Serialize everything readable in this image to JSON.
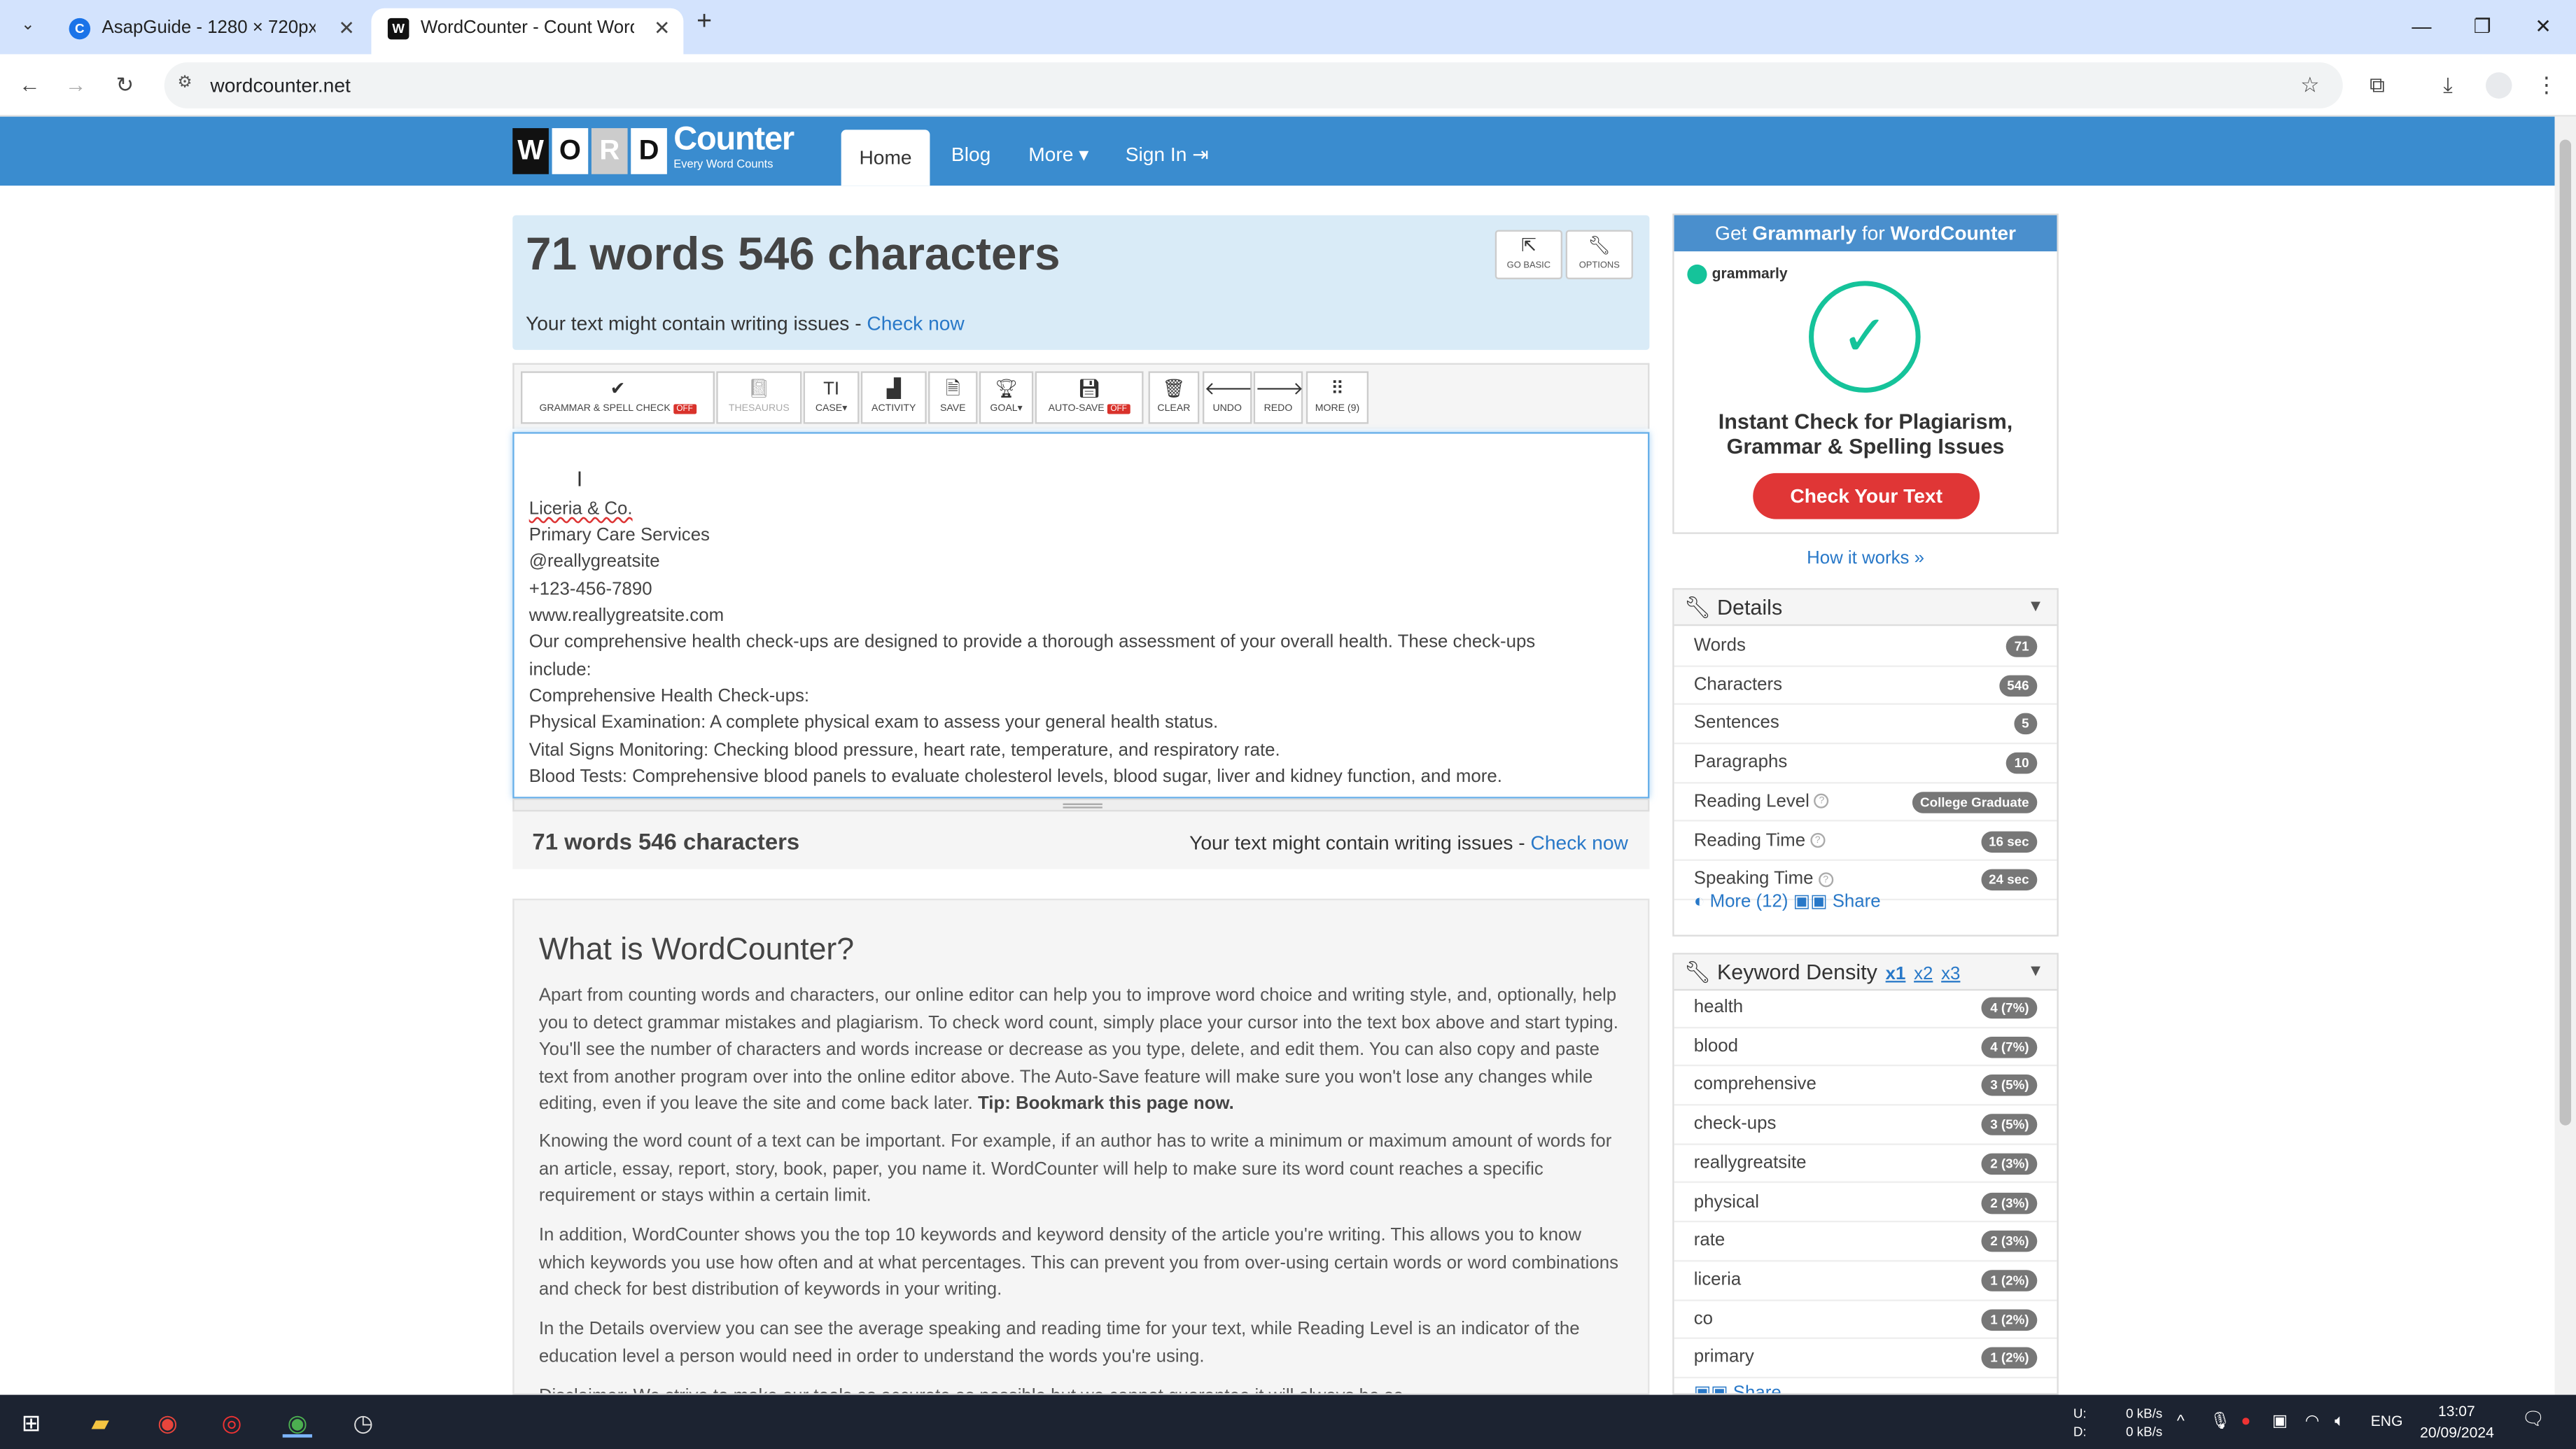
{
  "browser": {
    "tabs": [
      {
        "title": "AsapGuide - 1280 × 720px",
        "favicon": "C"
      },
      {
        "title": "WordCounter - Count Words &",
        "favicon": "W"
      }
    ],
    "url": "wordcounter.net"
  },
  "site": {
    "logo_letters": [
      "W",
      "O",
      "R",
      "D"
    ],
    "logo_word": "Counter",
    "logo_tagline": "Every Word Counts",
    "nav": {
      "home": "Home",
      "blog": "Blog",
      "more": "More ▾",
      "signin": "Sign In ⇥"
    }
  },
  "counter": {
    "headline": "71 words 546 characters",
    "issues_text": "Your text might contain writing issues - ",
    "check_now": "Check now",
    "go_basic": "GO BASIC",
    "options": "OPTIONS"
  },
  "toolbar": {
    "grammar": "GRAMMAR & SPELL CHECK",
    "off": "OFF",
    "thesaurus": "THESAURUS",
    "case": "CASE▾",
    "activity": "ACTIVITY",
    "save": "SAVE",
    "goal": "GOAL▾",
    "autosave": "AUTO-SAVE",
    "clear": "CLEAR",
    "undo": "UNDO",
    "redo": "REDO",
    "more": "MORE (9)"
  },
  "editor": {
    "lines": [
      "Liceria & Co.",
      "Primary Care Services",
      "@reallygreatsite",
      "+123-456-7890",
      "www.reallygreatsite.com",
      "Our comprehensive health check-ups are designed to provide a thorough assessment of your overall health. These check-ups",
      "include:",
      "Comprehensive Health Check-ups:",
      "Physical Examination: A complete physical exam to assess your general health status.",
      "Vital Signs Monitoring: Checking blood pressure, heart rate, temperature, and respiratory rate.",
      "Blood Tests: Comprehensive blood panels to evaluate cholesterol levels, blood sugar, liver and kidney function, and more."
    ]
  },
  "about": {
    "title": "What is WordCounter?",
    "p1": "Apart from counting words and characters, our online editor can help you to improve word choice and writing style, and, optionally, help you to detect grammar mistakes and plagiarism. To check word count, simply place your cursor into the text box above and start typing. You'll see the number of characters and words increase or decrease as you type, delete, and edit them. You can also copy and paste text from another program over into the online editor above. The Auto-Save feature will make sure you won't lose any changes while editing, even if you leave the site and come back later. ",
    "p1_tip": "Tip: Bookmark this page now.",
    "p2": "Knowing the word count of a text can be important. For example, if an author has to write a minimum or maximum amount of words for an article, essay, report, story, book, paper, you name it. WordCounter will help to make sure its word count reaches a specific requirement or stays within a certain limit.",
    "p3": "In addition, WordCounter shows you the top 10 keywords and keyword density of the article you're writing. This allows you to know which keywords you use how often and at what percentages. This can prevent you from over-using certain words or word combinations and check for best distribution of keywords in your writing.",
    "p4": "In the Details overview you can see the average speaking and reading time for your text, while Reading Level is an indicator of the education level a person would need in order to understand the words you're using.",
    "p5": "Disclaimer: We strive to make our tools as accurate as possible but we cannot guarantee it will always be so."
  },
  "ad": {
    "head_prefix": "Get ",
    "head_brand": "Grammarly",
    "head_mid": " for ",
    "head_site": "WordCounter",
    "brand": "grammarly",
    "text": "Instant Check for Plagiarism, Grammar & Spelling Issues",
    "button": "Check Your Text",
    "how": "How it works »"
  },
  "details": {
    "title": "Details",
    "rows": [
      {
        "k": "Words",
        "v": "71"
      },
      {
        "k": "Characters",
        "v": "546"
      },
      {
        "k": "Sentences",
        "v": "5"
      },
      {
        "k": "Paragraphs",
        "v": "10"
      },
      {
        "k": "Reading Level",
        "v": "College Graduate"
      },
      {
        "k": "Reading Time",
        "v": "16 sec"
      },
      {
        "k": "Speaking Time",
        "v": "24 sec"
      }
    ],
    "more": "More (12)",
    "share": "Share"
  },
  "keywords": {
    "title": "Keyword Density",
    "x1": "x1",
    "x2": "x2",
    "x3": "x3",
    "rows": [
      {
        "k": "health",
        "v": "4 (7%)"
      },
      {
        "k": "blood",
        "v": "4 (7%)"
      },
      {
        "k": "comprehensive",
        "v": "3 (5%)"
      },
      {
        "k": "check-ups",
        "v": "3 (5%)"
      },
      {
        "k": "reallygreatsite",
        "v": "2 (3%)"
      },
      {
        "k": "physical",
        "v": "2 (3%)"
      },
      {
        "k": "rate",
        "v": "2 (3%)"
      },
      {
        "k": "liceria",
        "v": "1 (2%)"
      },
      {
        "k": "co",
        "v": "1 (2%)"
      },
      {
        "k": "primary",
        "v": "1 (2%)"
      }
    ],
    "share": "Share"
  },
  "taskbar": {
    "net_up": "0 kB/s",
    "net_down": "0 kB/s",
    "net_u": "U:",
    "net_d": "D:",
    "lang": "ENG",
    "time": "13:07",
    "date": "20/09/2024"
  },
  "colors": {
    "accent": "#3a8ccf",
    "link": "#2878c8",
    "badge": "#777777",
    "off": "#d9322b",
    "grammarly": "#15c39a"
  }
}
